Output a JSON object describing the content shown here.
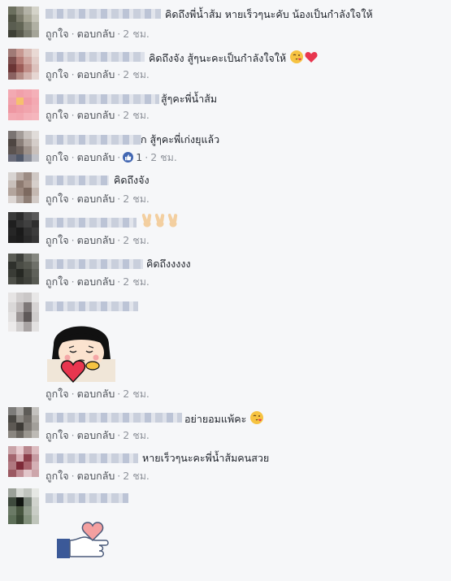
{
  "actions": {
    "like": "ถูกใจ",
    "reply": "ตอบกลับ",
    "sep": "·"
  },
  "comments": [
    {
      "text": "คิดถึงพี่น้ำส้ม หายเร็วๆนะคับ น้องเป็นกำลังใจให้",
      "time": "2 ชม."
    },
    {
      "text": "คิดถึงจัง สู้ๆนะคะเป็นกำลังใจให้",
      "time": "2 ชม.",
      "emoji": [
        "kiss-icon",
        "heart-icon"
      ]
    },
    {
      "text": "สู้ๆคะพี่น้ำส้ม",
      "time": "2 ชม."
    },
    {
      "text": "ก สู้ๆคะพี่เก่งยุแล้ว",
      "time": "2 ชม.",
      "likes": "1"
    },
    {
      "text": "คิดถึงจัง",
      "time": "2 ชม."
    },
    {
      "text": "",
      "time": "2 ชม.",
      "emoji": [
        "victory-hand-icon",
        "victory-hand-icon",
        "victory-hand-icon"
      ]
    },
    {
      "text": "คิดถึงงงงง",
      "time": "2 ชม."
    },
    {
      "text": "",
      "time": "2 ชม.",
      "sticker": "girl-holding-heart-sticker"
    },
    {
      "text": "อย่ายอมแพ้คะ",
      "time": "2 ชม.",
      "emoji": [
        "kiss-icon"
      ]
    },
    {
      "text": "หายเร็วๆนะคะพี่น้ำส้มคนสวย",
      "time": "2 ชม."
    },
    {
      "text": "",
      "sticker": "hand-holding-heart-sticker"
    }
  ],
  "colors": {
    "link": "#4b4f56",
    "meta": "#90949c",
    "like_blue": "#4267b2",
    "heart": "#e8364f"
  }
}
